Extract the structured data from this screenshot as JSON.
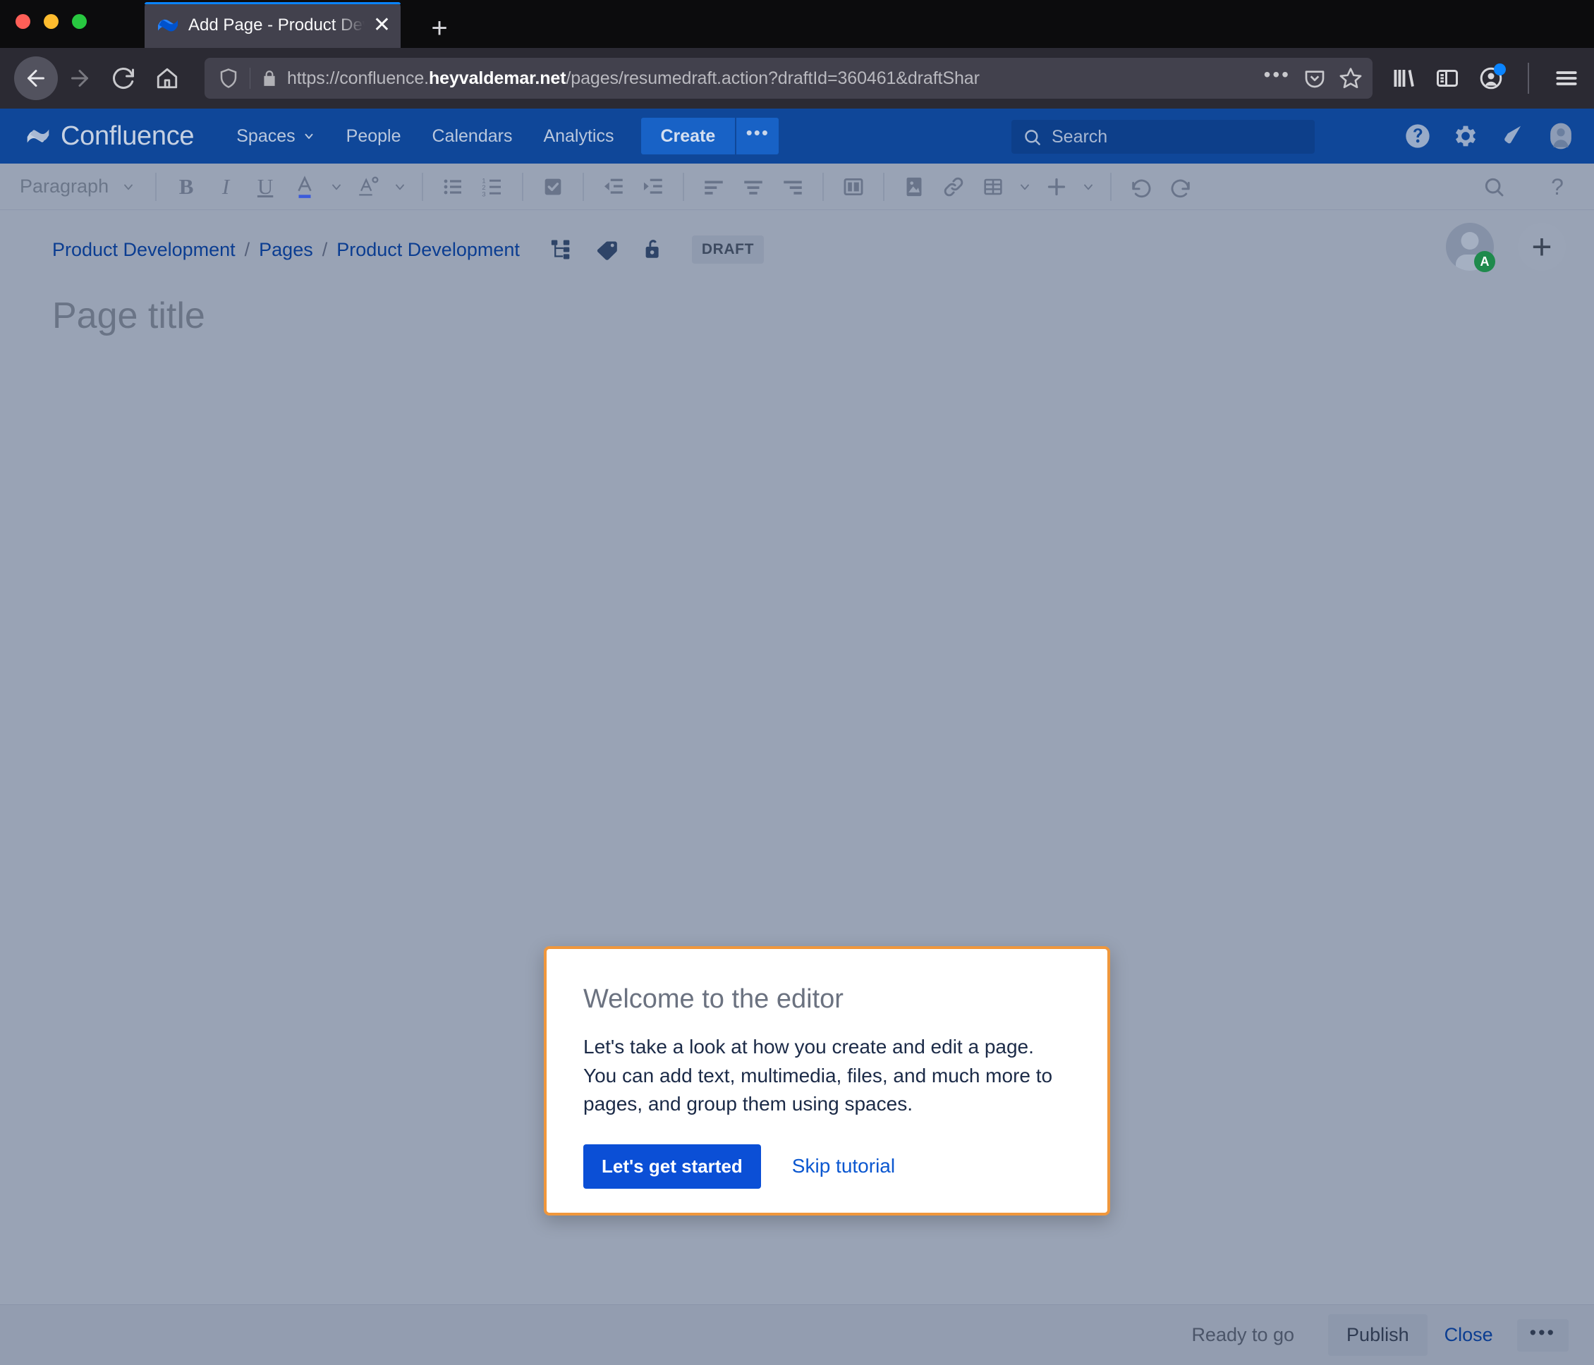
{
  "browser": {
    "tab": {
      "title": "Add Page - Product Development",
      "favicon_name": "confluence-favicon",
      "close_label": "✕"
    },
    "new_tab_label": "+",
    "url": {
      "scheme_and_sub": "https://confluence.",
      "domain": "heyvaldemar.net",
      "path": "/pages/resumedraft.action?draftId=360461&draftShar"
    },
    "nav": {
      "back": "back-arrow",
      "forward": "forward-arrow",
      "reload": "reload-arrow",
      "home": "home-house"
    },
    "toolbar_icons": [
      "library-icon",
      "sidebar-icon",
      "account-icon",
      "menu-icon"
    ]
  },
  "confluence_nav": {
    "logo_text": "Confluence",
    "items": [
      {
        "label": "Spaces",
        "has_chevron": true
      },
      {
        "label": "People",
        "has_chevron": false
      },
      {
        "label": "Calendars",
        "has_chevron": false
      },
      {
        "label": "Analytics",
        "has_chevron": false
      }
    ],
    "create_label": "Create",
    "create_more_label": "•••",
    "search_placeholder": "Search",
    "right_icons": [
      "help-icon",
      "gear-icon",
      "notification-icon",
      "profile-icon"
    ]
  },
  "editor_toolbar": {
    "style_label": "Paragraph",
    "buttons": [
      "bold-icon",
      "italic-icon",
      "underline-icon",
      "text-color-icon",
      "text-highlight-icon",
      "bullet-list-icon",
      "numbered-list-icon",
      "task-list-icon",
      "outdent-icon",
      "indent-icon",
      "align-left-icon",
      "align-center-icon",
      "align-right-icon",
      "page-layout-icon",
      "insert-image-icon",
      "insert-link-icon",
      "insert-table-icon",
      "insert-more-icon",
      "undo-icon",
      "redo-icon"
    ],
    "right_icons": [
      "find-replace-icon",
      "help-icon"
    ]
  },
  "breadcrumb": {
    "items": [
      "Product Development",
      "Pages",
      "Product Development"
    ],
    "separator": "/",
    "icons": [
      "page-hierarchy-icon",
      "labels-icon",
      "restrictions-unlocked-icon"
    ],
    "status_badge": "DRAFT"
  },
  "page": {
    "title_placeholder": "Page title",
    "avatar_badge": "A",
    "add_collaborator_label": "+"
  },
  "modal": {
    "title": "Welcome to the editor",
    "body": "Let's take a look at how you create and edit a page. You can add text, multimedia, files, and much more to pages, and group them using spaces.",
    "primary_button": "Let's get started",
    "secondary_link": "Skip tutorial",
    "border_color": "#f0973c"
  },
  "footer": {
    "status": "Ready to go",
    "publish_label": "Publish",
    "close_label": "Close",
    "more_label": "•••"
  },
  "colors": {
    "confluence_blue": "#0f4799",
    "create_blue": "#1862c6",
    "dim_background": "#99a3b5",
    "link_blue": "#0b3d91",
    "primary_button": "#0b4fd6",
    "badge_green": "#1f8a4c"
  }
}
